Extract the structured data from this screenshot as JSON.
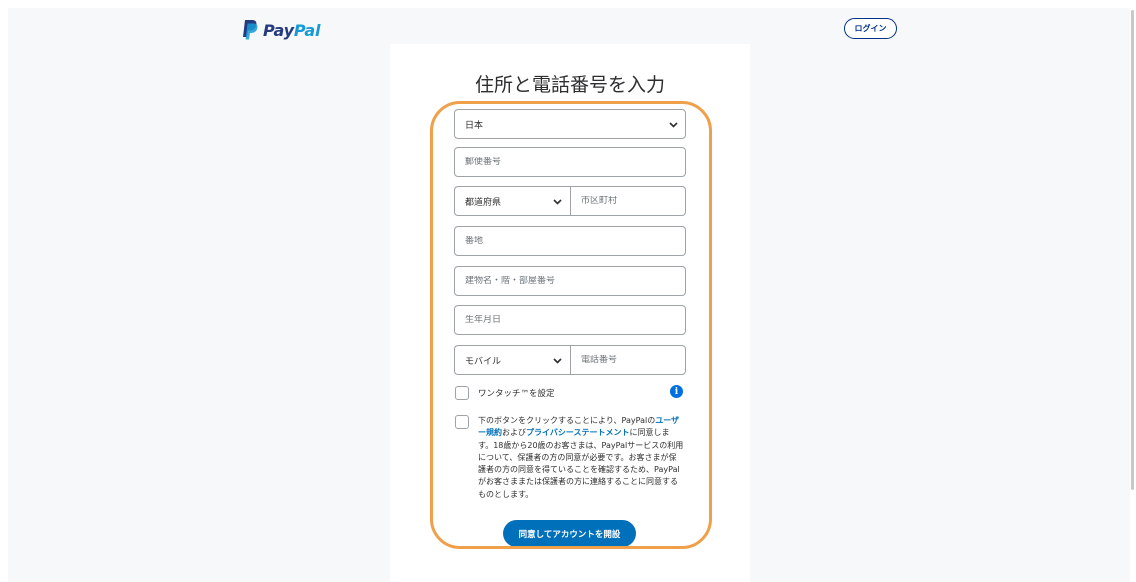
{
  "header": {
    "logo_text_pay": "Pay",
    "logo_text_pal": "Pal",
    "login_label": "ログイン"
  },
  "form": {
    "title": "住所と電話番号を入力",
    "country_value": "日本",
    "postal_placeholder": "郵便番号",
    "prefecture_value": "都道府県",
    "city_placeholder": "市区町村",
    "street_placeholder": "番地",
    "building_placeholder": "建物名・階・部屋番号",
    "birthdate_placeholder": "生年月日",
    "phone_type_value": "モバイル",
    "phone_placeholder": "電話番号",
    "onetouch_label": "ワンタッチ™を設定",
    "info_icon_glyph": "i",
    "legal": {
      "part1": "下のボタンをクリックすることにより、PayPalの",
      "link_terms": "ユーザー規約",
      "part2": "および",
      "link_privacy": "プライバシーステートメント",
      "part3": "に同意します。18歳から20歳のお客さまは、PayPalサービスの利用について、保護者の方の同意が必要です。お客さまが保護者の方の同意を得ていることを確認するため、PayPalがお客さままたは保護者の方に連絡することに同意するものとします。"
    },
    "submit_label": "同意してアカウントを開設"
  },
  "colors": {
    "paypal_dark_blue": "#253b80",
    "paypal_light_blue": "#179bd7",
    "button_blue": "#0070ba",
    "highlight_orange": "#f0a04b"
  }
}
